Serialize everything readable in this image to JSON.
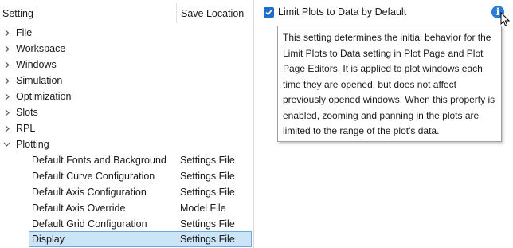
{
  "tree": {
    "header": {
      "setting": "Setting",
      "save_location": "Save Location"
    },
    "categories": [
      {
        "label": "File"
      },
      {
        "label": "Workspace"
      },
      {
        "label": "Windows"
      },
      {
        "label": "Simulation"
      },
      {
        "label": "Optimization"
      },
      {
        "label": "Slots"
      },
      {
        "label": "RPL"
      },
      {
        "label": "Plotting"
      }
    ],
    "plotting_children": [
      {
        "label": "Default Fonts and Background",
        "location": "Settings File"
      },
      {
        "label": "Default Curve Configuration",
        "location": "Settings File"
      },
      {
        "label": "Default Axis Configuration",
        "location": "Settings File"
      },
      {
        "label": "Default Axis Override",
        "location": "Model File"
      },
      {
        "label": "Default Grid Configuration",
        "location": "Settings File"
      },
      {
        "label": "Display",
        "location": "Settings File"
      }
    ],
    "selected_item": "Display"
  },
  "settings": {
    "limit_plots": {
      "label": "Limit Plots to Data by Default",
      "checked": true
    }
  },
  "tooltip": {
    "text": "This setting determines the initial behavior for the Limit Plots to Data setting in Plot Page and Plot Page Editors. It is applied to plot windows each time they are opened, but does not affect previously opened windows. When this property is enabled, zooming and panning in the plots are limited to the range of the plot's data."
  },
  "icons": {
    "info": "info-icon",
    "check": "check-icon",
    "expand": "chevron-right-icon",
    "collapse": "chevron-down-icon",
    "cursor": "mouse-pointer-icon"
  },
  "colors": {
    "selection_bg": "#cce4f7",
    "selection_border": "#6aa8db",
    "accent": "#1f6fc6",
    "info": "#2b7bd6"
  }
}
